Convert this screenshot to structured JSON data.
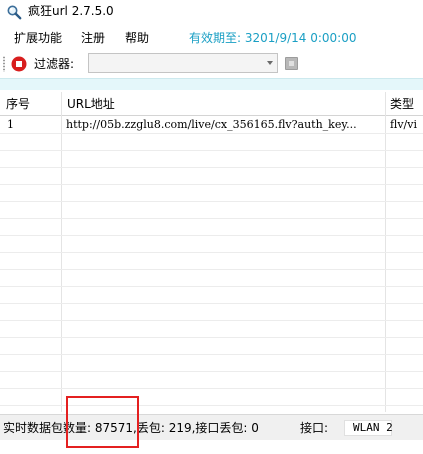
{
  "window": {
    "title": "疯狂url  2.7.5.0",
    "icon": "magnifier-icon"
  },
  "menu": {
    "items": [
      "扩展功能",
      "注册",
      "帮助"
    ],
    "expiry_label": "有效期至: 3201/9/14 0:00:00",
    "expiry_color": "#1a9fc4"
  },
  "toolbar": {
    "stop_icon": "stop-record-icon",
    "filter_label": "过滤器:",
    "filter_value": ""
  },
  "table": {
    "columns": [
      "序号",
      "URL地址",
      "类型"
    ],
    "rows": [
      {
        "index": "1",
        "url": "http://05b.zzglu8.com/live/cx_356165.flv?auth_key...",
        "type": "flv/vi"
      }
    ]
  },
  "status": {
    "realtime_label": "实时数据包数量: 87571,丢包: 219,接口丢包: 0",
    "interface_label": "接口:",
    "interface_value": "WLAN 2"
  },
  "colors": {
    "accent": "#1a9fc4",
    "stop_red": "#d81e1e",
    "highlight": "#e42020",
    "header_strip": "#e4f7fa"
  }
}
